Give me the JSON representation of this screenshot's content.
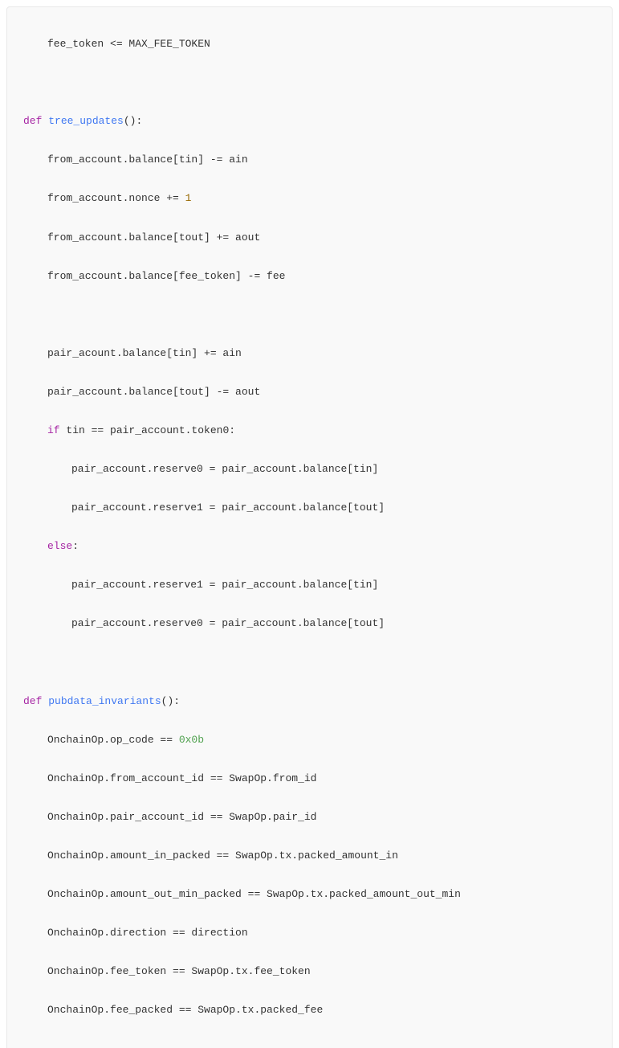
{
  "code": {
    "line01": "fee_token <= MAX_FEE_TOKEN",
    "def1_kw": "def",
    "def1_name": "tree_updates",
    "def1_paren": "():",
    "l03": "from_account.balance[tin] -= ain",
    "l04a": "from_account.nonce += ",
    "l04b": "1",
    "l05": "from_account.balance[tout] += aout",
    "l06": "from_account.balance[fee_token] -= fee",
    "l08": "pair_acount.balance[tin] += ain",
    "l09": "pair_account.balance[tout] -= aout",
    "if_kw": "if",
    "l10": " tin == pair_account.token0:",
    "l11": "pair_account.reserve0 = pair_account.balance[tin]",
    "l12": "pair_account.reserve1 = pair_account.balance[tout]",
    "else_kw": "else",
    "else_colon": ":",
    "l14": "pair_account.reserve1 = pair_account.balance[tin]",
    "l15": "pair_account.reserve0 = pair_account.balance[tout]",
    "def2_kw": "def",
    "def2_name": "pubdata_invariants",
    "def2_paren": "():",
    "l17a": "OnchainOp.op_code == ",
    "l17b": "0x0b",
    "l18": "OnchainOp.from_account_id == SwapOp.from_id",
    "l19": "OnchainOp.pair_account_id == SwapOp.pair_id",
    "l20": "OnchainOp.amount_in_packed == SwapOp.tx.packed_amount_in",
    "l21": "OnchainOp.amount_out_min_packed == SwapOp.tx.packed_amount_out_min",
    "l22": "OnchainOp.direction == direction",
    "l23": "OnchainOp.fee_token == SwapOp.tx.fee_token",
    "l24": "OnchainOp.fee_packed == SwapOp.tx.packed_fee"
  }
}
